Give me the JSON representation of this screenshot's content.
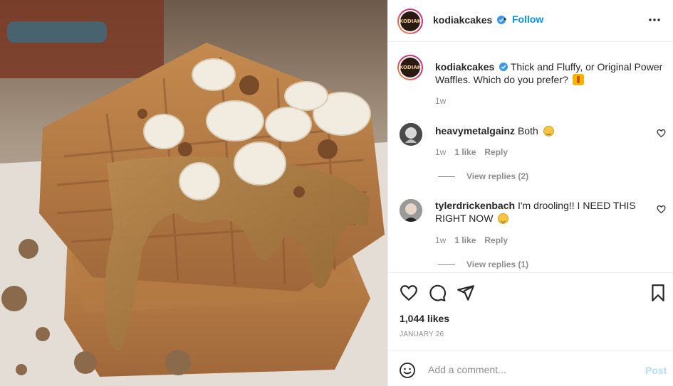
{
  "header": {
    "username": "kodiakcakes",
    "separator": "•",
    "follow_label": "Follow",
    "more_icon": "ellipsis-icon",
    "verified_icon": "verified-badge-icon"
  },
  "avatar_text": "KODIAK",
  "caption": {
    "username": "kodiakcakes",
    "text": "Thick and Fluffy, or Original Power Waffles. Which do you prefer?",
    "emoji": "waffle-emoji-icon",
    "time": "1w"
  },
  "comments": [
    {
      "username": "heavymetalgainz",
      "text": "Both",
      "emoji": "smiling-face-icon",
      "time": "1w",
      "likes": "1 like",
      "reply_label": "Reply",
      "view_replies": "View replies (2)"
    },
    {
      "username": "tylerdrickenbach",
      "text": "I'm drooling!! I NEED THIS RIGHT NOW",
      "emoji": "grimacing-face-icon",
      "time": "1w",
      "likes": "1 like",
      "reply_label": "Reply",
      "view_replies": "View replies (1)"
    }
  ],
  "actions": {
    "like_icon": "heart-icon",
    "comment_icon": "comment-icon",
    "share_icon": "paper-plane-icon",
    "save_icon": "bookmark-icon"
  },
  "likes": "1,044 likes",
  "date": "JANUARY 26",
  "add_comment": {
    "placeholder": "Add a comment...",
    "post_label": "Post"
  },
  "colors": {
    "accent": "#0095f6",
    "muted": "#8e8e8e",
    "post_disabled": "#b2dffc"
  }
}
